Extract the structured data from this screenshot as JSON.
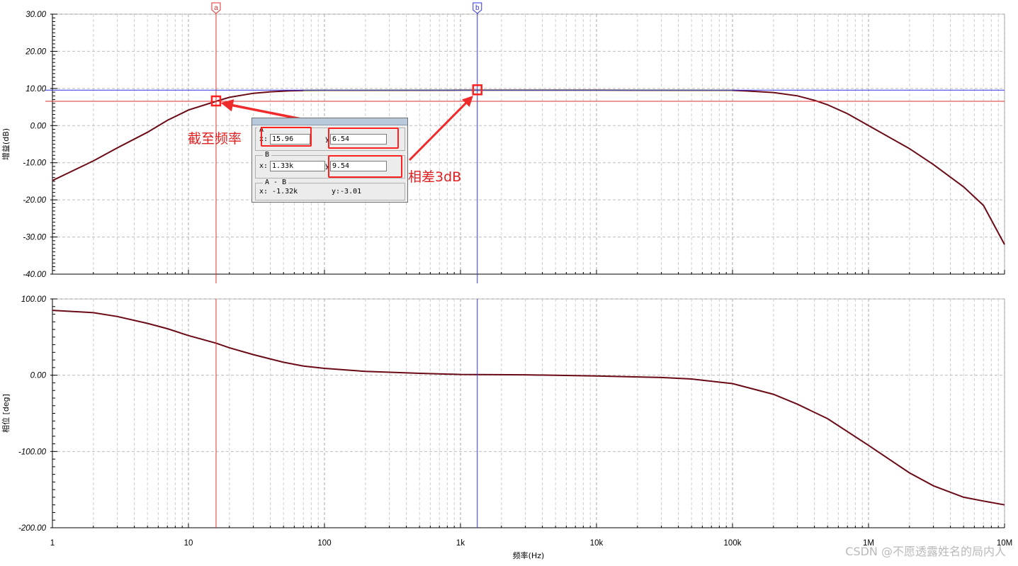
{
  "chart_data": [
    {
      "type": "line",
      "title": "",
      "xlabel": "频率(Hz)",
      "ylabel": "增益(dB)",
      "xscale": "log",
      "xlim": [
        1,
        10000000
      ],
      "ylim": [
        -40,
        30
      ],
      "ytick_labels": [
        "30.00",
        "20.00",
        "10.00",
        "0.00",
        "-10.00",
        "-20.00",
        "-30.00",
        "-40.00"
      ],
      "ytick_values": [
        30,
        20,
        10,
        0,
        -10,
        -20,
        -30,
        -40
      ],
      "grid": true,
      "colors": {
        "curve": "#6b0a17",
        "flat_overlay": "#9aa61e",
        "cursor_a": "#e03030",
        "cursor_b": "#3030e0"
      },
      "series": [
        {
          "x": [
            1,
            2,
            3,
            5,
            7,
            10,
            15.96,
            20,
            30,
            40,
            55,
            70,
            100,
            1000,
            10000,
            100000,
            130000,
            200000,
            300000,
            400000,
            500000,
            700000,
            1000000,
            2000000,
            3000000,
            5000000,
            7000000,
            10000000
          ],
          "y": [
            -14.8,
            -9.5,
            -6.0,
            -1.8,
            1.4,
            4.2,
            6.54,
            7.6,
            8.7,
            9.1,
            9.35,
            9.45,
            9.5,
            9.54,
            9.54,
            9.5,
            9.3,
            8.9,
            8.0,
            6.8,
            5.6,
            3.2,
            0.0,
            -6.2,
            -10.5,
            -16.5,
            -21.5,
            -32.0
          ]
        }
      ]
    },
    {
      "type": "line",
      "title": "",
      "xlabel": "频率(Hz)",
      "ylabel": "相位 [deg]",
      "xscale": "log",
      "xlim": [
        1,
        10000000
      ],
      "ylim": [
        -200,
        100
      ],
      "ytick_labels": [
        "100.00",
        "0.00",
        "-100.00",
        "-200.00"
      ],
      "ytick_values": [
        100,
        0,
        -100,
        -200
      ],
      "grid": true,
      "series": [
        {
          "x": [
            1,
            2,
            3,
            5,
            7,
            10,
            15.96,
            20,
            30,
            50,
            70,
            100,
            200,
            500,
            1000,
            3000,
            10000,
            30000,
            50000,
            100000,
            200000,
            300000,
            500000,
            1000000,
            2000000,
            3000000,
            5000000,
            7000000,
            10000000
          ],
          "y": [
            85,
            82,
            77,
            68,
            61,
            52,
            42,
            36,
            27,
            17,
            12,
            9,
            5,
            2.5,
            1,
            0.5,
            -1,
            -3,
            -5,
            -11,
            -25,
            -38,
            -57,
            -92,
            -128,
            -145,
            -160,
            -165,
            -170
          ]
        }
      ]
    }
  ],
  "x_ticks": [
    {
      "v": 1,
      "label": "1"
    },
    {
      "v": 10,
      "label": "10"
    },
    {
      "v": 100,
      "label": "100"
    },
    {
      "v": 1000,
      "label": "1k"
    },
    {
      "v": 10000,
      "label": "10k"
    },
    {
      "v": 100000,
      "label": "100k"
    },
    {
      "v": 1000000,
      "label": "1M"
    },
    {
      "v": 10000000,
      "label": "10M"
    }
  ],
  "cursors": {
    "a": {
      "tag": "a",
      "x": 15.96,
      "y": 6.54
    },
    "b": {
      "tag": "b",
      "x": 1330,
      "y": 9.54
    }
  },
  "readout": {
    "a_group": "A",
    "b_group": "B",
    "diff_group": "A - B",
    "x_label": "x:",
    "y_label": "y:",
    "a_x": "15.96",
    "a_y": "6.54",
    "b_x": "1.33k",
    "b_y": "9.54",
    "diff_x": "x: -1.32k",
    "diff_y": "y:-3.01"
  },
  "annotations": {
    "cutoff_text": "截至频率",
    "diff_text": "相差3dB"
  },
  "watermark": "CSDN @不愿透露姓名的局内人"
}
